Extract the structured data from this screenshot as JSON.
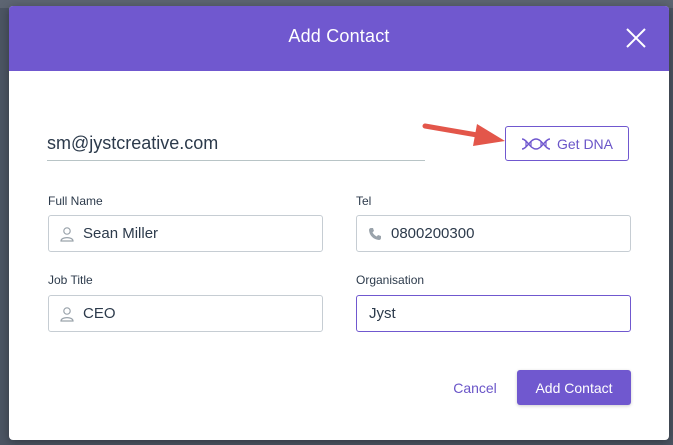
{
  "modal": {
    "title": "Add Contact",
    "email_value": "sm@jystcreative.com",
    "get_dna_label": "Get DNA",
    "fields": {
      "full_name": {
        "label": "Full Name",
        "value": "Sean Miller",
        "icon": "user-icon"
      },
      "tel": {
        "label": "Tel",
        "value": "0800200300",
        "icon": "phone-icon"
      },
      "job_title": {
        "label": "Job Title",
        "value": "CEO",
        "icon": "user-icon"
      },
      "organisation": {
        "label": "Organisation",
        "value": "Jyst"
      }
    },
    "cancel_label": "Cancel",
    "submit_label": "Add Contact"
  },
  "colors": {
    "accent": "#7058cf",
    "annotation_arrow": "#e3564a",
    "backdrop": "#4c5563"
  }
}
